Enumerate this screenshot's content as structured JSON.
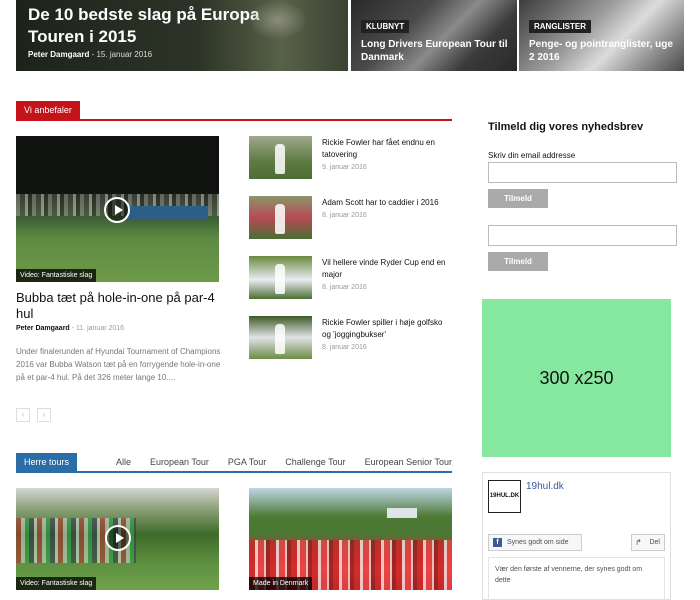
{
  "hero": {
    "main": {
      "title": "De 10 bedste slag på Europa Touren i 2015",
      "author": "Peter Damgaard",
      "date": "15. januar 2016"
    },
    "tiles": [
      {
        "category": "KLUBNYT",
        "title": "Long Drivers European Tour til Danmark"
      },
      {
        "category": "RANGLISTER",
        "title": "Penge- og pointranglister, uge 2 2016"
      }
    ]
  },
  "recommend": {
    "header": "Vi anbefaler",
    "featured": {
      "video_label": "Video: Fantastiske slag",
      "title": "Bubba tæt på hole-in-one på par-4 hul",
      "author": "Peter Damgaard",
      "date": "11. januar 2016",
      "excerpt": "Under finalerunden af Hyundai Tournament of Champions 2016 var Bubba Watson tæt på en forrygende hole-in-one på et par-4 hul. På det 326 meter lange 10...."
    },
    "items": [
      {
        "title": "Rickie Fowler har fået endnu en tatovering",
        "date": "9. januar 2016"
      },
      {
        "title": "Adam Scott har to caddier i 2016",
        "date": "8. januar 2016"
      },
      {
        "title": "Vil hellere vinde Ryder Cup end en major",
        "date": "8. januar 2016"
      },
      {
        "title": "Rickie Fowler spiller i høje golfsko og 'joggingbukser'",
        "date": "8. januar 2016"
      }
    ],
    "pager": {
      "prev": "‹",
      "next": "›"
    }
  },
  "tours": {
    "header": "Herre tours",
    "filters": [
      "Alle",
      "European Tour",
      "PGA Tour",
      "Challenge Tour",
      "European Senior Tour"
    ],
    "videos": [
      {
        "label": "Video: Fantastiske slag"
      },
      {
        "label": "Made in Denmark"
      }
    ]
  },
  "newsletter": {
    "title": "Tilmeld dig vores nyhedsbrev",
    "email_label": "Skriv din email addresse",
    "email_value": "",
    "button": "Tilmeld",
    "second_value": "",
    "second_button": "Tilmeld"
  },
  "ad": {
    "text": "300 x250"
  },
  "facebook": {
    "logo_text": "19HUL.DK",
    "page_name": "19hul.dk",
    "like_label": "Synes godt om side",
    "like_icon": "f",
    "share_label": "Del",
    "share_icon": "↱",
    "friends_text": "Vær den første af vennerne, der synes godt om dette"
  }
}
